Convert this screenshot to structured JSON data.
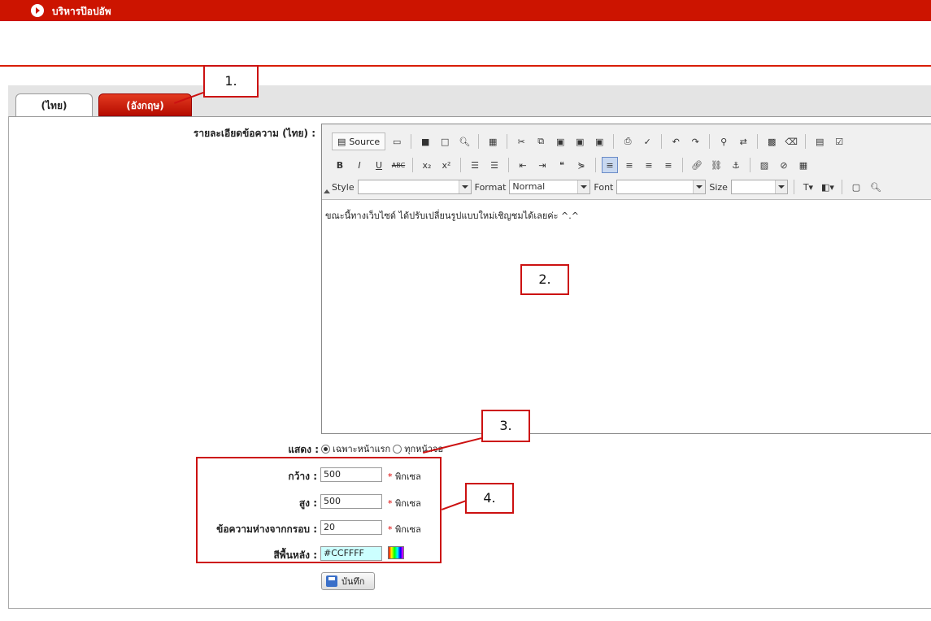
{
  "header": {
    "title": "บริหารป๊อปอัพ"
  },
  "tabs": [
    {
      "label": "(ไทย)"
    },
    {
      "label": "(อังกฤษ)"
    }
  ],
  "editor": {
    "label": "รายละเอียดข้อความ (ไทย) :",
    "source_label": "Source",
    "style_label": "Style",
    "format_label": "Format",
    "format_value": "Normal",
    "font_label": "Font",
    "size_label": "Size",
    "content": "ขณะนี้ทางเว็บไซด์ ได้ปรับเปลี่ยนรูปแบบใหม่เชิญชมได้เลยค่ะ ^.^"
  },
  "display": {
    "label": "แสดง :",
    "options": [
      {
        "label": "เฉพาะหน้าแรก",
        "checked": true
      },
      {
        "label": "ทุกหน้าจอ",
        "checked": false
      }
    ]
  },
  "settings": {
    "width": {
      "label": "กว้าง :",
      "value": "500",
      "unit": "พิกเซล"
    },
    "height": {
      "label": "สูง :",
      "value": "500",
      "unit": "พิกเซล"
    },
    "padding": {
      "label": "ข้อความห่างจากกรอบ :",
      "value": "20",
      "unit": "พิกเซล"
    },
    "bgcolor": {
      "label": "สีพื้นหลัง :",
      "value": "#CCFFFF"
    }
  },
  "save_label": "บันทึก",
  "annotations": [
    "1.",
    "2.",
    "3.",
    "4."
  ],
  "colors": {
    "header": "#cc1400",
    "annotation": "#cc1111",
    "bg_color_field": "#CCFFFF"
  }
}
